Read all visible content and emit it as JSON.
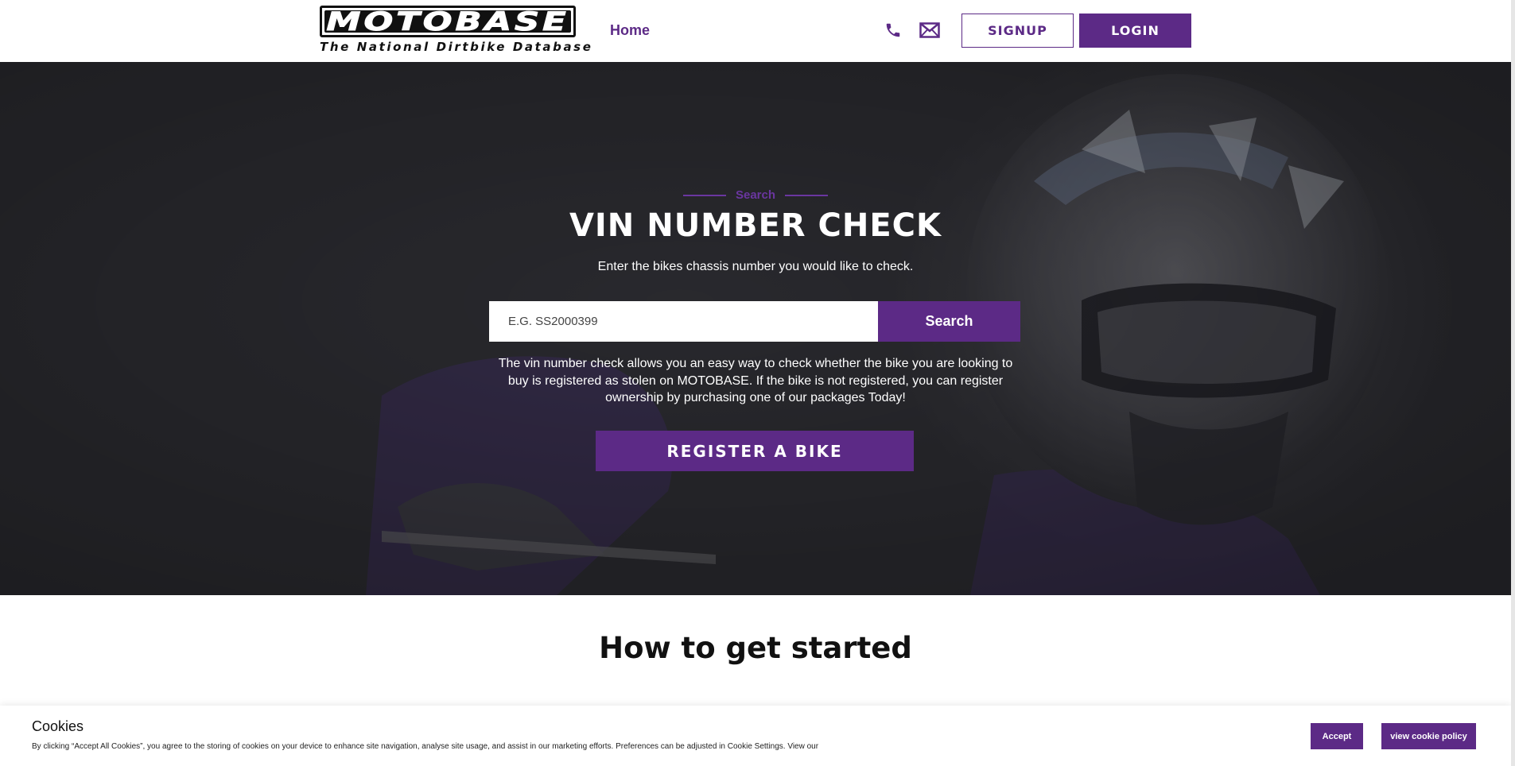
{
  "header": {
    "logo_word": "MOTOBASE",
    "logo_tagline": "The National Dirtbike Database",
    "nav_home": "Home",
    "signup_label": "SIGNUP",
    "login_label": "LOGIN",
    "icons": [
      "phone-icon",
      "mail-icon"
    ]
  },
  "hero": {
    "eyebrow": "Search",
    "title": "VIN NUMBER CHECK",
    "subtitle": "Enter the bikes chassis number you would like to check.",
    "search_placeholder": "E.G. SS2000399",
    "search_value": "",
    "search_button": "Search",
    "description": "The vin number check allows you an easy way to check whether the bike you are looking to buy is registered as stolen on MOTOBASE. If the bike is not registered, you can register ownership by purchasing one of our packages Today!",
    "register_button": "REGISTER A BIKE"
  },
  "section": {
    "title": "How to get started"
  },
  "cookie": {
    "title": "Cookies",
    "text": "By clicking “Accept All Cookies”, you agree to the storing of cookies on your device to enhance site navigation, analyse site usage, and assist in our marketing efforts. Preferences can be adjusted in Cookie Settings. View our",
    "accept_label": "Accept",
    "policy_label": "view cookie policy"
  },
  "colors": {
    "brand_purple": "#5c2a86",
    "accent_purple": "#6a36a0",
    "hero_dark": "#2d2d32"
  }
}
